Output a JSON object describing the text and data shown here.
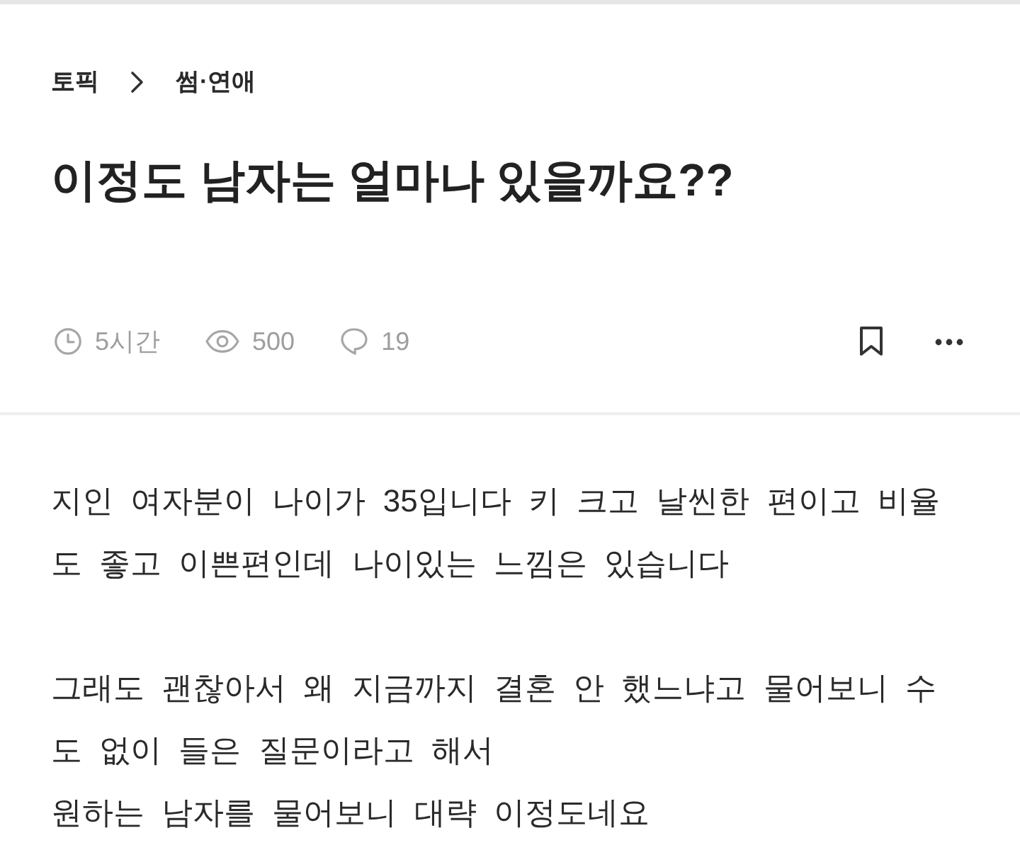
{
  "breadcrumb": [
    {
      "label": "토픽"
    },
    {
      "label": "썸·연애"
    }
  ],
  "post": {
    "title": "이정도 남자는 얼마나 있을까요??",
    "meta": [
      {
        "kind": "time",
        "text": "5시간"
      },
      {
        "kind": "views",
        "text": "500"
      },
      {
        "kind": "comments",
        "text": "19"
      }
    ],
    "actions": [
      {
        "kind": "bookmark",
        "bookmarked": false
      },
      {
        "kind": "more"
      }
    ],
    "paragraphs": [
      [
        "지인 여자분이 나이가 35입니다 키 크고 날씬한 편이고 비율도 좋고 이쁜편인데 나이있는 느낌은 있습니다"
      ],
      [
        "그래도 괜찮아서 왜 지금까지 결혼 안 했느냐고 물어보니 수도 없이 들은 질문이라고 해서",
        "원하는 남자를 물어보니 대략 이정도네요"
      ]
    ]
  }
}
